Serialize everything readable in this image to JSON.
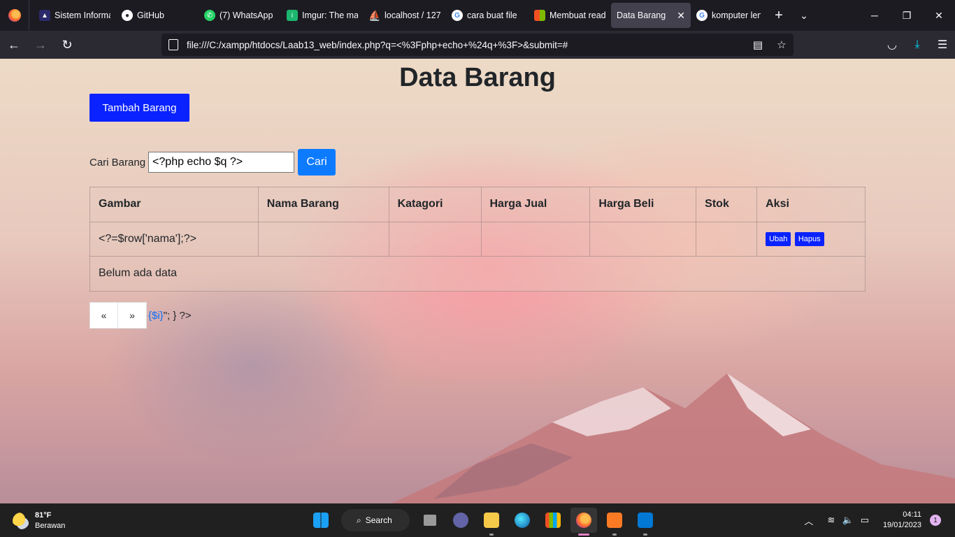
{
  "browser": {
    "tabs": [
      {
        "title": "Sistem Informasi",
        "favicon": "site-icon",
        "color": "#2b2a6b"
      },
      {
        "title": "GitHub",
        "favicon": "github-icon",
        "color": "#24292f"
      },
      {
        "title": "(7) WhatsApp",
        "favicon": "whatsapp-icon",
        "color": "#25d366"
      },
      {
        "title": "Imgur: The magic",
        "favicon": "imgur-icon",
        "color": "#1bb76e"
      },
      {
        "title": "localhost / 127",
        "favicon": "phpmyadmin-icon",
        "color": "#f29111"
      },
      {
        "title": "cara buat file",
        "favicon": "google-icon",
        "color": "#ffffff"
      },
      {
        "title": "Membuat read",
        "favicon": "microsoft-icon",
        "color": "#f25022"
      },
      {
        "title": "Data Barang",
        "favicon": "",
        "color": "",
        "active": true
      },
      {
        "title": "komputer lenovo",
        "favicon": "google-icon",
        "color": "#ffffff"
      }
    ],
    "url": "file:///C:/xampp/htdocs/Laab13_web/index.php?q=<%3Fphp+echo+%24q+%3F>&submit=#"
  },
  "page": {
    "title": "Data Barang",
    "add_button": "Tambah Barang",
    "search": {
      "label": "Cari Barang",
      "value": "<?php echo $q ?>",
      "button": "Cari"
    },
    "table": {
      "headers": [
        "Gambar",
        "Nama Barang",
        "Katagori",
        "Harga Jual",
        "Harga Beli",
        "Stok",
        "Aksi"
      ],
      "row": {
        "gambar": "<?=$row['nama'];?>",
        "edit": "Ubah",
        "delete": "Hapus"
      },
      "empty_message": "Belum ada data"
    },
    "pagination": {
      "prev": "«",
      "next": "»",
      "tail_link": "{$i}",
      "tail_text": "\"; } ?>"
    }
  },
  "taskbar": {
    "weather_temp": "81°F",
    "weather_desc": "Berawan",
    "search_label": "Search",
    "time": "04:11",
    "date": "19/01/2023",
    "notifications": "1"
  },
  "colors": {
    "primary_button": "#0a22ff",
    "search_button": "#0d7bff"
  }
}
